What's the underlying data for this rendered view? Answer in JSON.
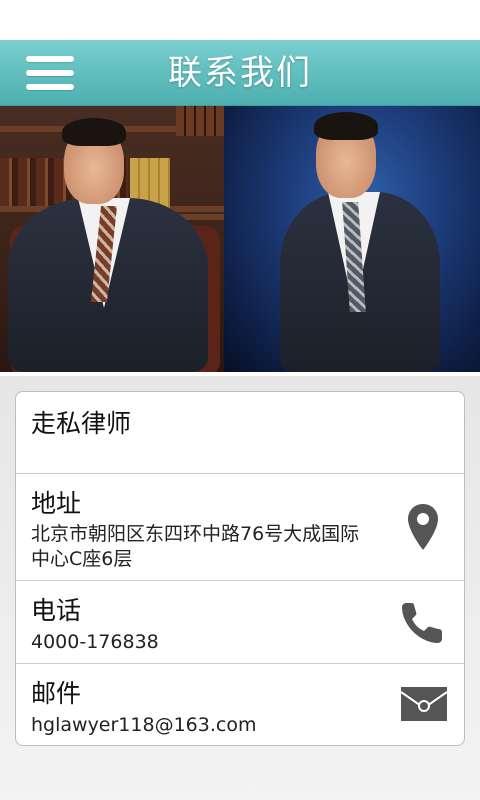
{
  "header": {
    "title": "联系我们"
  },
  "contact": {
    "firm": "走私律师",
    "address": {
      "label": "地址",
      "value_line1": "北京市朝阳区东四环中路76号大成国际",
      "value_line2": "中心C座6层"
    },
    "phone": {
      "label": "电话",
      "value": "4000-176838"
    },
    "email": {
      "label": "邮件",
      "value": "hglawyer118@163.com"
    }
  },
  "icons": {
    "menu": "menu-icon",
    "location": "location-pin-icon",
    "phone": "phone-icon",
    "mail": "envelope-icon"
  },
  "colors": {
    "header": "#5fbdbd",
    "icon_gray": "#555555"
  }
}
